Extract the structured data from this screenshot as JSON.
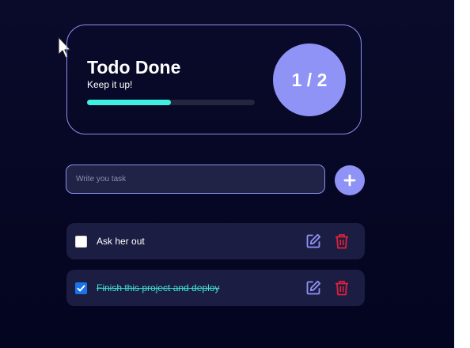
{
  "summary": {
    "title": "Todo Done",
    "subtitle": "Keep it up!",
    "completed": 1,
    "total": 2,
    "progress_fraction": 0.5,
    "counter_text": "1 / 2"
  },
  "new_task": {
    "placeholder": "Write you task",
    "value": ""
  },
  "add_button": {
    "icon": "plus-icon"
  },
  "todos": [
    {
      "text": "Ask her out",
      "done": false
    },
    {
      "text": "Finish this project and deploy",
      "done": true
    }
  ],
  "icons": {
    "edit": "edit-icon",
    "delete": "trash-icon",
    "cursor": "mouse-pointer-icon"
  },
  "colors": {
    "background": "#070826",
    "accent": "#8f93f6",
    "progress": "#3ef0e2",
    "done_text": "#3ee2cf",
    "delete": "#e0203a",
    "card": "#1c1d42"
  }
}
